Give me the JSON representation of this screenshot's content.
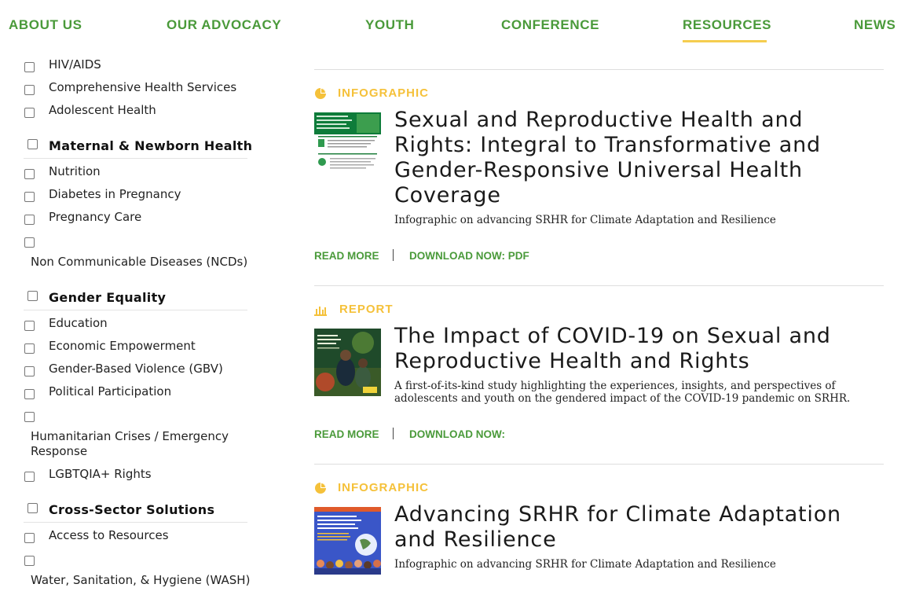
{
  "nav": {
    "items": [
      {
        "label": "ABOUT US"
      },
      {
        "label": "OUR ADVOCACY"
      },
      {
        "label": "YOUTH"
      },
      {
        "label": "CONFERENCE"
      },
      {
        "label": "RESOURCES",
        "active": true
      },
      {
        "label": "NEWS"
      }
    ],
    "accent_color": "#4a9a3a",
    "active_underline_color": "#f5cd4f"
  },
  "sidebar": {
    "items": [
      {
        "label": "HIV/AIDS",
        "type": "option",
        "checked": false
      },
      {
        "label": "Comprehensive Health Services",
        "type": "option",
        "checked": false
      },
      {
        "label": "Adolescent Health",
        "type": "option",
        "checked": false
      },
      {
        "label": "Maternal & Newborn Health",
        "type": "group",
        "checked": false
      },
      {
        "label": "Nutrition",
        "type": "option",
        "checked": false
      },
      {
        "label": "Diabetes in Pregnancy",
        "type": "option",
        "checked": false
      },
      {
        "label": "Pregnancy Care",
        "type": "option",
        "checked": false
      },
      {
        "label": "Non Communicable Diseases (NCDs)",
        "type": "option",
        "checked": false
      },
      {
        "label": "Gender Equality",
        "type": "group",
        "checked": false
      },
      {
        "label": "Education",
        "type": "option",
        "checked": false
      },
      {
        "label": "Economic Empowerment",
        "type": "option",
        "checked": false
      },
      {
        "label": "Gender-Based Violence (GBV)",
        "type": "option",
        "checked": false
      },
      {
        "label": "Political Participation",
        "type": "option",
        "checked": false
      },
      {
        "label": "Humanitarian Crises / Emergency Response",
        "type": "option",
        "checked": false
      },
      {
        "label": "LGBTQIA+ Rights",
        "type": "option",
        "checked": false
      },
      {
        "label": "Cross-Sector Solutions",
        "type": "group",
        "checked": false
      },
      {
        "label": "Access to Resources",
        "type": "option",
        "checked": false
      },
      {
        "label": "Water, Sanitation, & Hygiene (WASH)",
        "type": "option",
        "checked": false
      }
    ]
  },
  "resources": [
    {
      "type_label": "INFOGRAPHIC",
      "type_icon": "pie-chart-icon",
      "title": "Sexual and Reproductive Health and Rights: Integral to Transformative and Gender-Responsive Universal Health Coverage",
      "description": "Infographic on advancing SRHR for Climate Adaptation and Resilience",
      "read_more": "READ MORE",
      "download": "DOWNLOAD NOW: PDF"
    },
    {
      "type_label": "REPORT",
      "type_icon": "bar-chart-icon",
      "title": "The Impact of COVID-19 on Sexual and Reproductive Health and Rights",
      "description": "A first-of-its-kind study highlighting the experiences, insights, and perspectives of adolescents and youth on the gendered impact of the COVID-19 pandemic on SRHR.",
      "read_more": "READ MORE",
      "download": "DOWNLOAD NOW:"
    },
    {
      "type_label": "INFOGRAPHIC",
      "type_icon": "pie-chart-icon",
      "title": "Advancing SRHR for Climate Adaptation and Resilience",
      "description": "Infographic on advancing SRHR for Climate Adaptation and Resilience"
    }
  ],
  "colors": {
    "brand_green": "#4a9a3a",
    "type_yellow": "#f5c13a",
    "divider": "#dedede"
  }
}
